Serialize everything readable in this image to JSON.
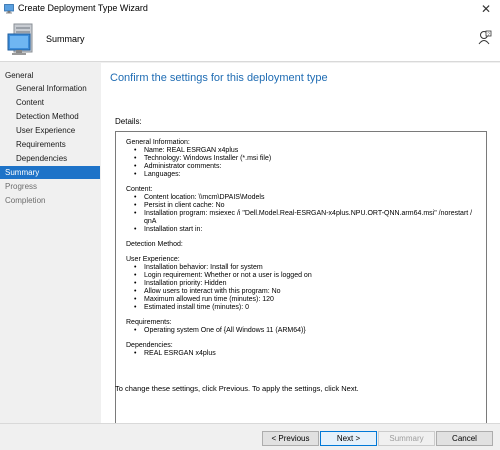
{
  "window": {
    "title": "Create Deployment Type Wizard"
  },
  "header": {
    "page_name": "Summary"
  },
  "nav": [
    {
      "label": "General",
      "level": 0,
      "state": "normal"
    },
    {
      "label": "General Information",
      "level": 1,
      "state": "normal"
    },
    {
      "label": "Content",
      "level": 1,
      "state": "normal"
    },
    {
      "label": "Detection Method",
      "level": 1,
      "state": "normal"
    },
    {
      "label": "User Experience",
      "level": 1,
      "state": "normal"
    },
    {
      "label": "Requirements",
      "level": 1,
      "state": "normal"
    },
    {
      "label": "Dependencies",
      "level": 1,
      "state": "normal"
    },
    {
      "label": "Summary",
      "level": 0,
      "state": "active"
    },
    {
      "label": "Progress",
      "level": 0,
      "state": "muted"
    },
    {
      "label": "Completion",
      "level": 0,
      "state": "muted"
    }
  ],
  "main": {
    "heading": "Confirm the settings for this deployment type",
    "details_label": "Details:",
    "sections": [
      {
        "title": "General Information:",
        "items": [
          "Name: REAL ESRGAN x4plus",
          "Technology: Windows Installer (*.msi file)",
          "Administrator comments:",
          "Languages:"
        ]
      },
      {
        "title": "Content:",
        "items": [
          "Content location: \\\\mcm\\DPAIS\\Models",
          "Persist in client cache: No",
          "Installation program: msiexec /i \"Dell.Model.Real-ESRGAN-x4plus.NPU.ORT-QNN.arm64.msi\" /norestart /",
          "qnA",
          "Installation start in:"
        ]
      },
      {
        "title": "Detection Method:",
        "items": []
      },
      {
        "title": "User Experience:",
        "items": [
          "Installation behavior: Install for system",
          "Login requirement: Whether or not a user is logged on",
          "Installation priority: Hidden",
          "Allow users to interact with this program: No",
          "Maximum allowed run time (minutes): 120",
          "Estimated install time (minutes): 0"
        ]
      },
      {
        "title": "Requirements:",
        "items": [
          "Operating system  One of  {All Windows 11 (ARM64)}"
        ]
      },
      {
        "title": "Dependencies:",
        "items": [
          "REAL ESRGAN x4plus"
        ]
      }
    ],
    "footer_note": "To change these settings, click Previous. To apply the settings, click Next."
  },
  "buttons": {
    "previous": "< Previous",
    "next": "Next >",
    "summary": "Summary",
    "cancel": "Cancel"
  },
  "colors": {
    "accent": "#1e73c8",
    "heading": "#1f6cb3"
  },
  "icons": {
    "window": "computer-icon",
    "header": "computer-icon",
    "help": "user-help-icon"
  }
}
